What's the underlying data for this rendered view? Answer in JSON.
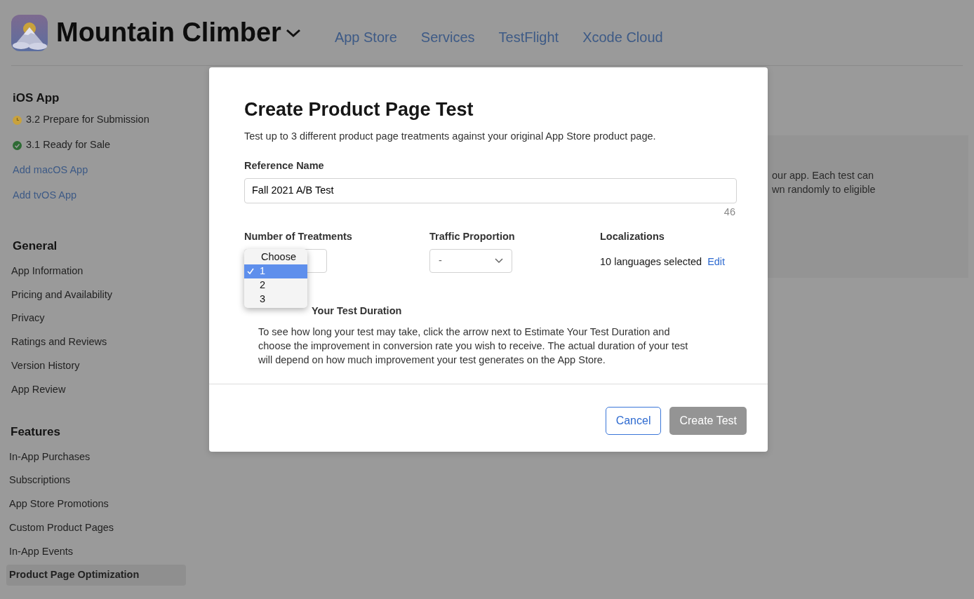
{
  "app": {
    "title": "Mountain Climber",
    "tabs": [
      "App Store",
      "Services",
      "TestFlight",
      "Xcode Cloud"
    ]
  },
  "sidebar": {
    "platform": {
      "title": "iOS App",
      "versions": [
        {
          "label": "3.2 Prepare for Submission",
          "kind": "clock",
          "color": "#c9a23c"
        },
        {
          "label": "3.1 Ready for Sale",
          "kind": "check",
          "color": "#2e6b34"
        }
      ],
      "links": [
        "Add macOS App",
        "Add tvOS App"
      ]
    },
    "sections": [
      {
        "title": "General",
        "items": [
          {
            "label": "App Information",
            "selected": false
          },
          {
            "label": "Pricing and Availability",
            "selected": false
          },
          {
            "label": "Privacy",
            "selected": false
          },
          {
            "label": "Ratings and Reviews",
            "selected": false
          },
          {
            "label": "Version History",
            "selected": false
          },
          {
            "label": "App Review",
            "selected": false
          }
        ]
      },
      {
        "title": "Features",
        "items": [
          {
            "label": "In-App Purchases",
            "selected": false
          },
          {
            "label": "Subscriptions",
            "selected": false
          },
          {
            "label": "App Store Promotions",
            "selected": false
          },
          {
            "label": "Custom Product Pages",
            "selected": false
          },
          {
            "label": "In-App Events",
            "selected": false
          },
          {
            "label": "Product Page Optimization",
            "selected": true
          }
        ]
      }
    ]
  },
  "background_text": [
    "our app. Each test can",
    "wn randomly to eligible"
  ],
  "dialog": {
    "title": "Create Product Page Test",
    "description": "Test up to 3 different product page treatments against your original App Store product page.",
    "reference_name": {
      "label": "Reference Name",
      "value": "Fall 2021 A/B Test",
      "counter": "46"
    },
    "treatments": {
      "label": "Number of Treatments",
      "options": [
        {
          "label": "Choose",
          "selected": false
        },
        {
          "label": "1",
          "selected": true
        },
        {
          "label": "2",
          "selected": false
        },
        {
          "label": "3",
          "selected": false
        }
      ]
    },
    "traffic": {
      "label": "Traffic Proportion",
      "value": "-"
    },
    "localizations": {
      "label": "Localizations",
      "value": "10 languages selected",
      "link": "Edit"
    },
    "estimate": {
      "title": "Your Test Duration",
      "text": "To see how long your test may take, click the arrow next to Estimate Your Test Duration and choose the improvement in conversion rate you wish to receive. The actual duration of your test will depend on how much improvement your test generates on the App Store."
    },
    "buttons": [
      {
        "label": "Cancel",
        "disabled": false,
        "kind": "secondary"
      },
      {
        "label": "Create Test",
        "disabled": true,
        "kind": "primary"
      }
    ]
  }
}
